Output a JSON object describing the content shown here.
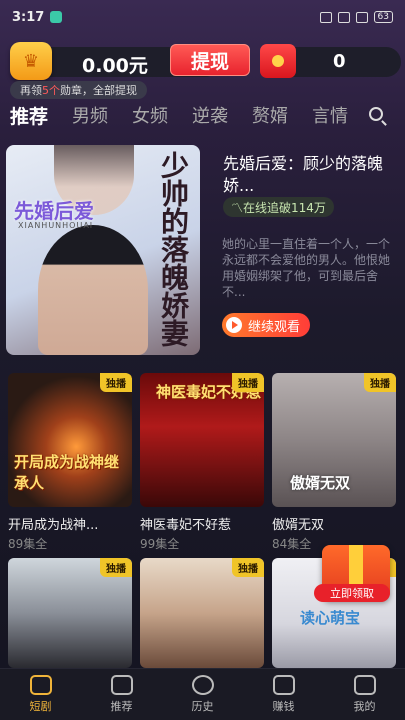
{
  "status": {
    "time": "3:17",
    "battery": "63"
  },
  "wallet": {
    "balance": "0.00元",
    "withdraw_label": "提现",
    "redpack_count": "0",
    "hint_prefix": "再领",
    "hint_highlight": "5个",
    "hint_suffix": "勋章，全部提现"
  },
  "tabs": [
    "推荐",
    "男频",
    "女频",
    "逆袭",
    "赘婿",
    "言情"
  ],
  "feature": {
    "cover_title_vertical": "少帅的落魄娇妻",
    "cover_title_left": "先婚后爱",
    "cover_sub": "XIANHUNHOUAI",
    "title": "先婚后爱：顾少的落魄娇...",
    "stat": "在线追破114万",
    "description": "她的心里一直住着一个人，一个永远都不会爱他的男人。他恨她用婚姻绑架了他，可到最后舍不...",
    "continue_label": "继续观看"
  },
  "cards": [
    {
      "name": "开局成为战神...",
      "eps": "89集全",
      "badge": "独播",
      "thumb_text": "开局成为战神继承人"
    },
    {
      "name": "神医毒妃不好惹",
      "eps": "99集全",
      "badge": "独播",
      "thumb_text": "神医毒妃不好惹"
    },
    {
      "name": "傲婿无双",
      "eps": "84集全",
      "badge": "独播",
      "thumb_text": "傲婿无双"
    },
    {
      "name": "",
      "eps": "",
      "badge": "独播",
      "thumb_text": ""
    },
    {
      "name": "",
      "eps": "",
      "badge": "独播",
      "thumb_text": ""
    },
    {
      "name": "",
      "eps": "",
      "badge": "独播",
      "thumb_text": "读心萌宝"
    }
  ],
  "gift": {
    "label": "立即领取"
  },
  "nav": [
    "短剧",
    "推荐",
    "历史",
    "赚钱",
    "我的"
  ],
  "colors": {
    "accent": "#f0b43a",
    "withdraw": "#e8232e",
    "badge": "#f0c428"
  }
}
